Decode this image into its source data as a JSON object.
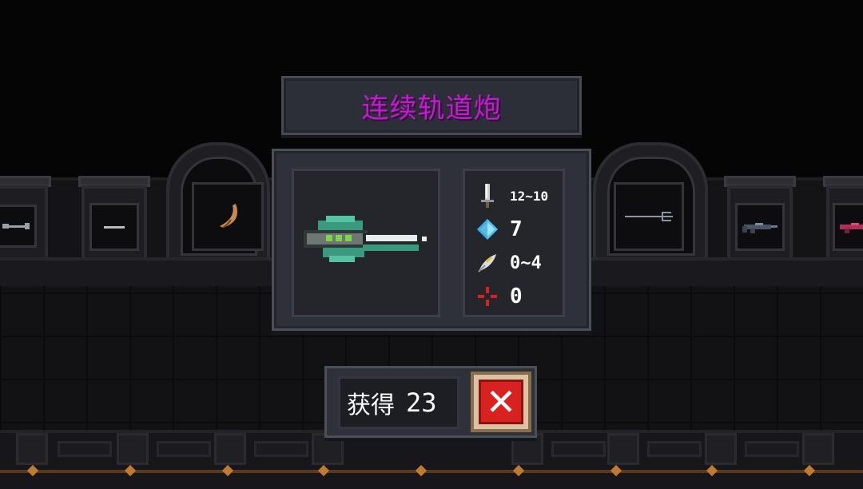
{
  "weapon": {
    "name": "连续轨道炮",
    "name_color": "#c21bd0",
    "icon": "railgun-icon"
  },
  "stats": [
    {
      "icon": "sword-icon",
      "name": "damage",
      "value": "12~10"
    },
    {
      "icon": "diamond-icon",
      "name": "energy",
      "value": "7"
    },
    {
      "icon": "feather-icon",
      "name": "critical",
      "value": "0~4"
    },
    {
      "icon": "crosshair-icon",
      "name": "spread",
      "value": "0"
    }
  ],
  "obtain": {
    "label": "获得",
    "count": "23"
  },
  "close_button": {
    "icon": "close-icon",
    "symbol": "✕",
    "color": "#d8221f"
  },
  "display_items": [
    {
      "icon": "wrench-icon"
    },
    {
      "icon": "stick-icon"
    },
    {
      "icon": "crescent-blade-icon"
    },
    {
      "icon": "trident-icon"
    },
    {
      "icon": "rifle-icon"
    },
    {
      "icon": "pink-rifle-icon"
    }
  ]
}
